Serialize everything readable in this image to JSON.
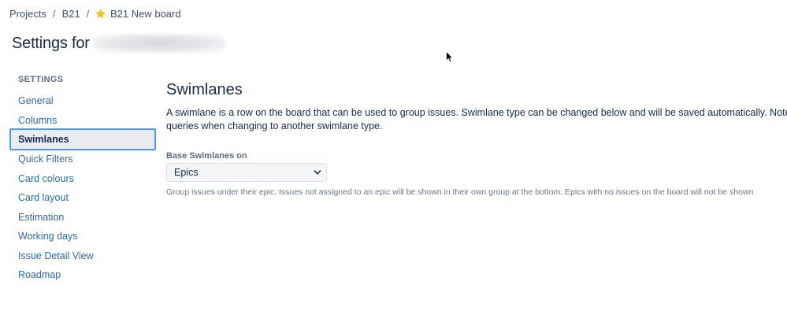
{
  "breadcrumb": {
    "projects": "Projects",
    "separator": "/",
    "project": "B21",
    "board": "B21 New board"
  },
  "header": {
    "title": "Settings for"
  },
  "sidebar": {
    "heading": "SETTINGS",
    "items": [
      {
        "label": "General"
      },
      {
        "label": "Columns"
      },
      {
        "label": "Swimlanes"
      },
      {
        "label": "Quick Filters"
      },
      {
        "label": "Card colours"
      },
      {
        "label": "Card layout"
      },
      {
        "label": "Estimation"
      },
      {
        "label": "Working days"
      },
      {
        "label": "Issue Detail View"
      },
      {
        "label": "Roadmap"
      }
    ],
    "active": "Swimlanes"
  },
  "main": {
    "title": "Swimlanes",
    "description": "A swimlane is a row on the board that can be used to group issues. Swimlane type can be changed below and will be saved automatically. Note: queries when changing to another swimlane type.",
    "field_label": "Base Swimlanes on",
    "select_value": "Epics",
    "help_text": "Group issues under their epic. Issues not assigned to an epic will be shown in their own group at the bottom. Epics with no issues on the board will not be shown."
  },
  "colors": {
    "link": "#2D6AB1",
    "text": "#172B4D",
    "focus_ring": "#4C9AFF",
    "active_bg": "#EBECF0",
    "star": "#F5C518"
  },
  "icons": [
    "star-icon",
    "chevron-down-icon",
    "cursor-icon"
  ]
}
